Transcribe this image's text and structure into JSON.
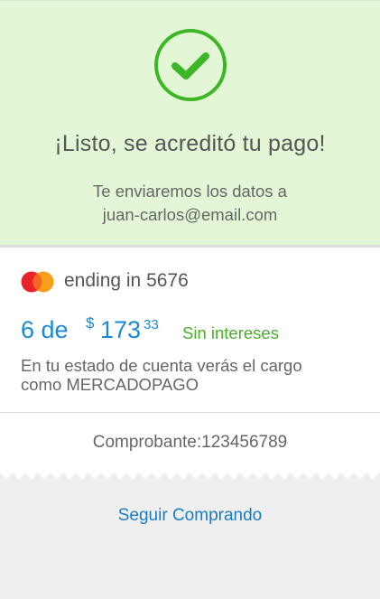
{
  "success": {
    "icon": "check-circle-icon",
    "title": "¡Listo, se acreditó tu pago!",
    "subtitle_line1": "Te enviaremos los datos a",
    "subtitle_line2": "juan-carlos@email.com"
  },
  "payment": {
    "card_icon": "mastercard-icon",
    "card_ending": "ending in 5676",
    "installments": "6 de",
    "currency": "$",
    "amount": "173",
    "cents": "33",
    "interest": "Sin intereses",
    "statement_line1": "En tu estado de cuenta verás el cargo",
    "statement_line2": "como MERCADOPAGO",
    "receipt": "Comprobante:123456789"
  },
  "actions": {
    "continue_label": "Seguir Comprando"
  },
  "colors": {
    "success_bg": "#e3f7d6",
    "success_green": "#3cb526",
    "accent_blue": "#1a8ad6",
    "page_bg": "#efefef"
  }
}
